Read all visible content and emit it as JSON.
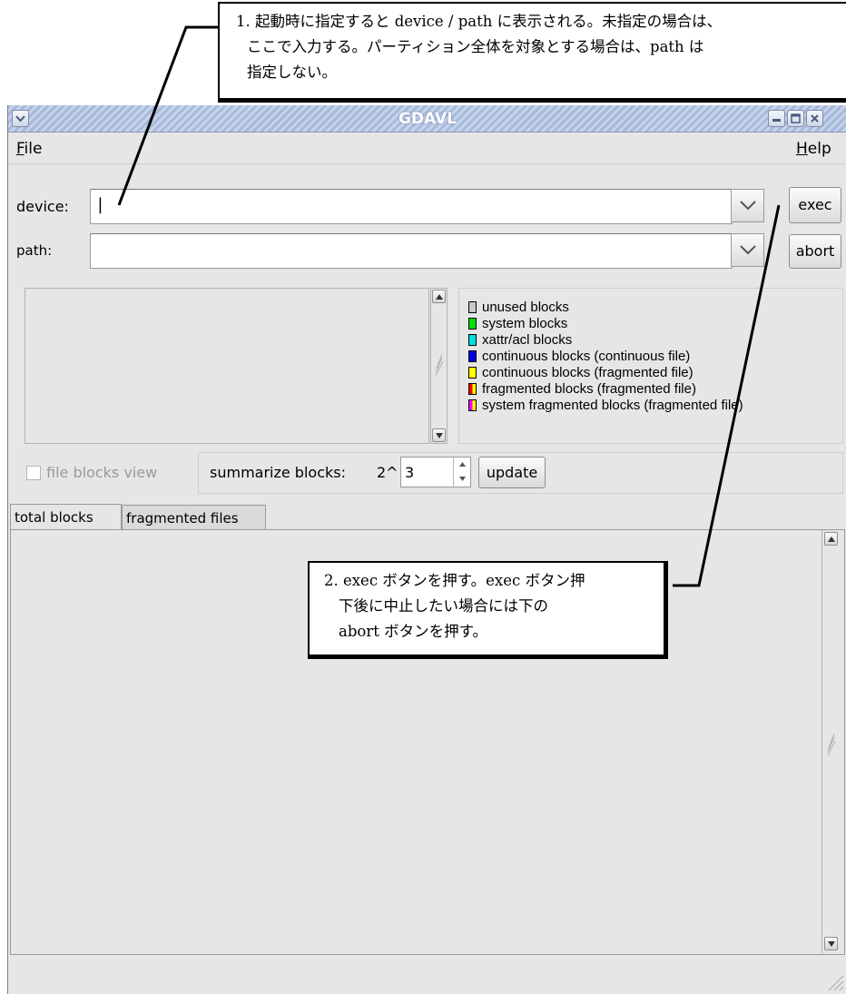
{
  "window": {
    "title": "GDAVL"
  },
  "menu": {
    "file": {
      "mnemonic": "F",
      "rest": "ile"
    },
    "help": {
      "mnemonic": "H",
      "rest": "elp"
    }
  },
  "form": {
    "device_label": "device:",
    "device_value": "|",
    "path_label": "path:",
    "path_value": "",
    "exec_label": "exec",
    "abort_label": "abort"
  },
  "legend": {
    "items": [
      {
        "label": "unused blocks",
        "color": "#c8c8c8"
      },
      {
        "label": "system blocks",
        "color": "#00e000"
      },
      {
        "label": "xattr/acl blocks",
        "color": "#00e0e0"
      },
      {
        "label": "continuous blocks (continuous file)",
        "color": "#0000e0"
      },
      {
        "label": "continuous blocks (fragmented file)",
        "color": "#ffff00"
      },
      {
        "label": "fragmented blocks (fragmented file)",
        "color_left": "#ff0000",
        "color_right": "#ffff00"
      },
      {
        "label": "system fragmented blocks (fragmented file)",
        "color_left": "#ff00ff",
        "color_right": "#ffff00"
      }
    ]
  },
  "controls": {
    "file_blocks_view_label": "file blocks view",
    "file_blocks_view_checked": false,
    "summarize_label": "summarize blocks:",
    "summarize_prefix": "2^",
    "summarize_value": "3",
    "update_label": "update"
  },
  "tabs": [
    {
      "label": "total blocks",
      "active": true
    },
    {
      "label": "fragmented files",
      "active": false
    }
  ],
  "callouts": {
    "c1": {
      "line1": "1. 起動時に指定すると device / path に表示される。未指定の場合は、",
      "line2": "ここで入力する。パーティション全体を対象とする場合は、path は",
      "line3": "指定しない。"
    },
    "c2": {
      "line1": "2. exec ボタンを押す。exec ボタン押",
      "line2": "下後に中止したい場合には下の",
      "line3": "abort ボタンを押す。"
    }
  }
}
